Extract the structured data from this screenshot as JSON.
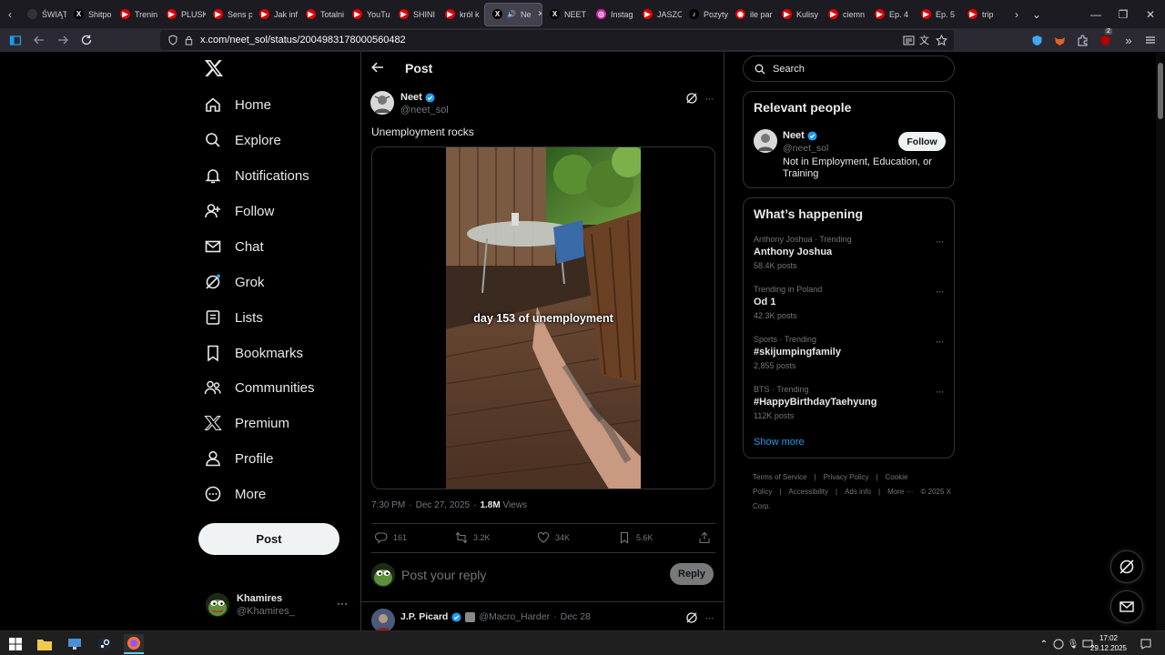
{
  "browser": {
    "tabs": [
      {
        "label": "ŚWIĄT",
        "color": "#333333",
        "glyph": ""
      },
      {
        "label": "Shitpo",
        "color": "#000000",
        "glyph": "X"
      },
      {
        "label": "Trenin",
        "color": "#e00000",
        "glyph": "▶"
      },
      {
        "label": "PLUSK",
        "color": "#e00000",
        "glyph": "▶"
      },
      {
        "label": "Sens p",
        "color": "#e00000",
        "glyph": "▶"
      },
      {
        "label": "Jak inf",
        "color": "#e00000",
        "glyph": "▶"
      },
      {
        "label": "Totalni",
        "color": "#e00000",
        "glyph": "▶"
      },
      {
        "label": "YouTu",
        "color": "#e00000",
        "glyph": "▶"
      },
      {
        "label": "SHINI",
        "color": "#e00000",
        "glyph": "▶"
      },
      {
        "label": "król k",
        "color": "#e00000",
        "glyph": "▶"
      },
      {
        "label": "Ne",
        "color": "#000000",
        "glyph": "X",
        "active": true
      },
      {
        "label": "NEET C",
        "color": "#000000",
        "glyph": "X"
      },
      {
        "label": "Instag",
        "color": "#d6249f",
        "glyph": "◎"
      },
      {
        "label": "JASZC",
        "color": "#e00000",
        "glyph": "▶"
      },
      {
        "label": "Pozyty",
        "color": "#000000",
        "glyph": "♪"
      },
      {
        "label": "ile par",
        "color": "#e00000",
        "glyph": "◉"
      },
      {
        "label": "Kulisy",
        "color": "#e00000",
        "glyph": "▶"
      },
      {
        "label": "ciemn",
        "color": "#e00000",
        "glyph": "▶"
      },
      {
        "label": "Ep. 4",
        "color": "#e00000",
        "glyph": "▶"
      },
      {
        "label": "Ep. 5",
        "color": "#e00000",
        "glyph": "▶"
      },
      {
        "label": "trip",
        "color": "#e00000",
        "glyph": "▶"
      }
    ],
    "url": "x.com/neet_sol/status/2004983178000560482",
    "ext_badge": "2"
  },
  "sidebar": {
    "items": [
      {
        "label": "Home",
        "icon": "home-icon"
      },
      {
        "label": "Explore",
        "icon": "search-icon"
      },
      {
        "label": "Notifications",
        "icon": "bell-icon"
      },
      {
        "label": "Follow",
        "icon": "person-add-icon"
      },
      {
        "label": "Chat",
        "icon": "mail-icon"
      },
      {
        "label": "Grok",
        "icon": "grok-icon"
      },
      {
        "label": "Lists",
        "icon": "list-icon"
      },
      {
        "label": "Bookmarks",
        "icon": "bookmark-icon"
      },
      {
        "label": "Communities",
        "icon": "people-icon"
      },
      {
        "label": "Premium",
        "icon": "x-logo-icon"
      },
      {
        "label": "Profile",
        "icon": "person-icon"
      },
      {
        "label": "More",
        "icon": "more-circle-icon"
      }
    ],
    "post_label": "Post",
    "account": {
      "name": "Khamires",
      "handle": "@Khamires_"
    }
  },
  "main": {
    "header_title": "Post",
    "post": {
      "author": "Neet",
      "handle": "@neet_sol",
      "text": "Unemployment rocks",
      "video_caption": "day 153 of unemployment",
      "time": "7:30 PM",
      "date": "Dec 27, 2025",
      "views_count": "1.8M",
      "views_label": "Views",
      "replies": "161",
      "reposts": "3.2K",
      "likes": "34K",
      "bookmarks": "5.6K"
    },
    "reply_placeholder": "Post your reply",
    "reply_button": "Reply",
    "first_reply": {
      "name": "J.P. Picard",
      "handle": "@Macro_Harder",
      "date": "Dec 28"
    }
  },
  "right": {
    "search_placeholder": "Search",
    "relevant_title": "Relevant people",
    "relevant": {
      "name": "Neet",
      "handle": "@neet_sol",
      "bio": "Not in Employment, Education, or Training",
      "follow_label": "Follow"
    },
    "happening_title": "What’s happening",
    "trends": [
      {
        "context": "Anthony Joshua · Trending",
        "name": "Anthony Joshua",
        "count": "58.4K posts"
      },
      {
        "context": "Trending in Poland",
        "name": "Od 1",
        "count": "42.3K posts"
      },
      {
        "context": "Sports · Trending",
        "name": "#skijumpingfamily",
        "count": "2,855 posts"
      },
      {
        "context": "BTS · Trending",
        "name": "#HappyBirthdayTaehyung",
        "count": "112K posts"
      }
    ],
    "show_more": "Show more",
    "footer": [
      "Terms of Service",
      "|",
      "Privacy Policy",
      "|",
      "Cookie Policy",
      "|",
      "Accessibility",
      "|",
      "Ads info",
      "|",
      "More ···",
      "© 2025 X Corp."
    ]
  },
  "taskbar": {
    "time": "17:02",
    "date": "29.12.2025"
  },
  "colors": {
    "accent": "#1d9bf0",
    "bg": "#000000",
    "border": "#2f3336",
    "muted": "#71767b"
  }
}
